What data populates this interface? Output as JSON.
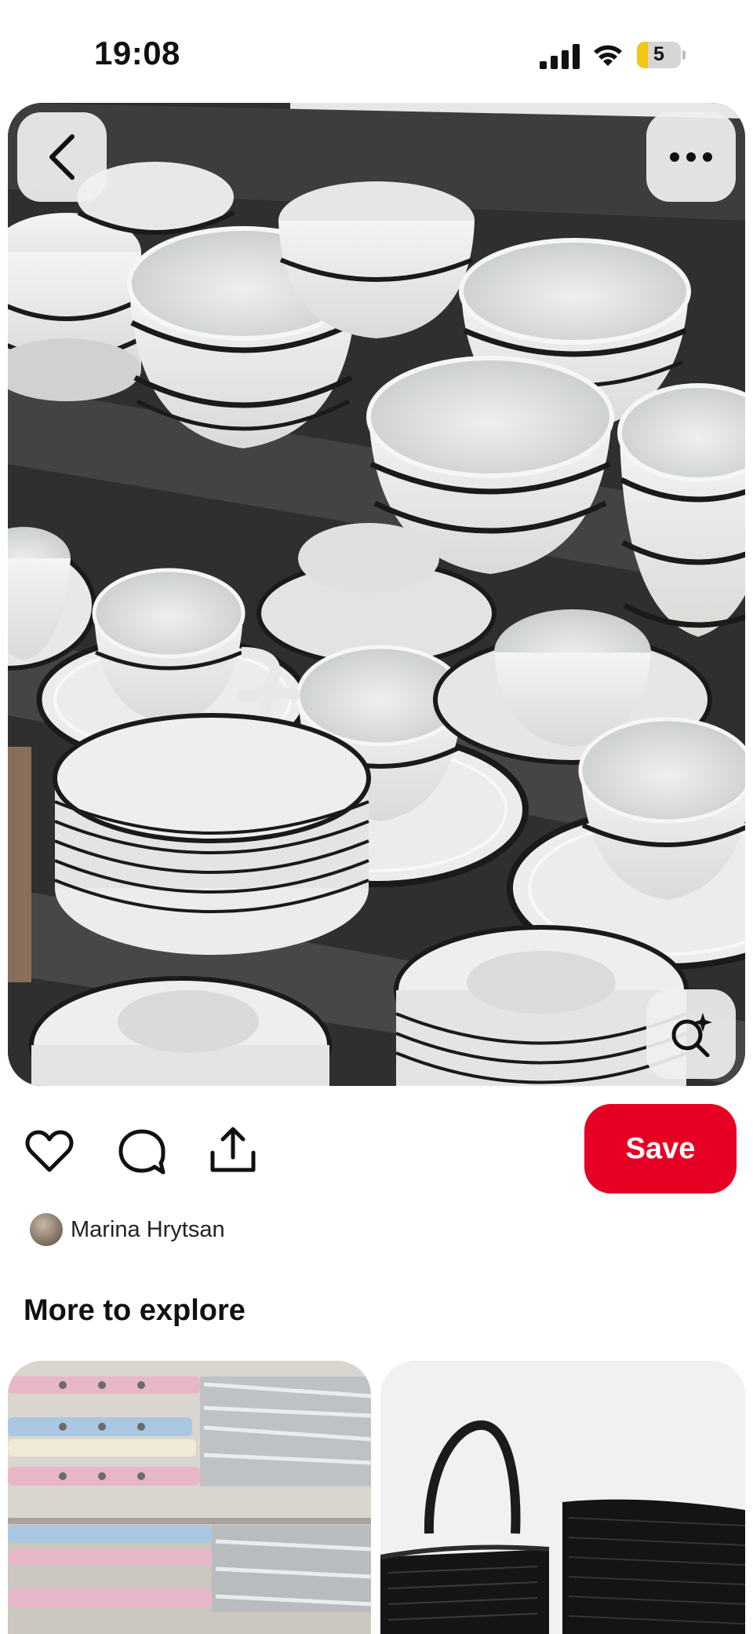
{
  "status_bar": {
    "time": "19:08",
    "battery": "5",
    "icons": [
      "cellular-signal-icon",
      "wifi-icon",
      "battery-icon"
    ]
  },
  "pin": {
    "image_description_icon": "photo",
    "overlay_buttons": [
      "back-icon",
      "more-icon",
      "visual-search-icon"
    ]
  },
  "actions": {
    "icons": [
      "heart-icon",
      "comment-icon",
      "share-icon"
    ],
    "save_label": "Save"
  },
  "creator": {
    "name": "Marina Hrytsan"
  },
  "explore": {
    "title": "More to explore"
  },
  "colors": {
    "save_red": "#e60023",
    "background": "#ffffff",
    "shelf_gray": "#3c3c3c"
  }
}
